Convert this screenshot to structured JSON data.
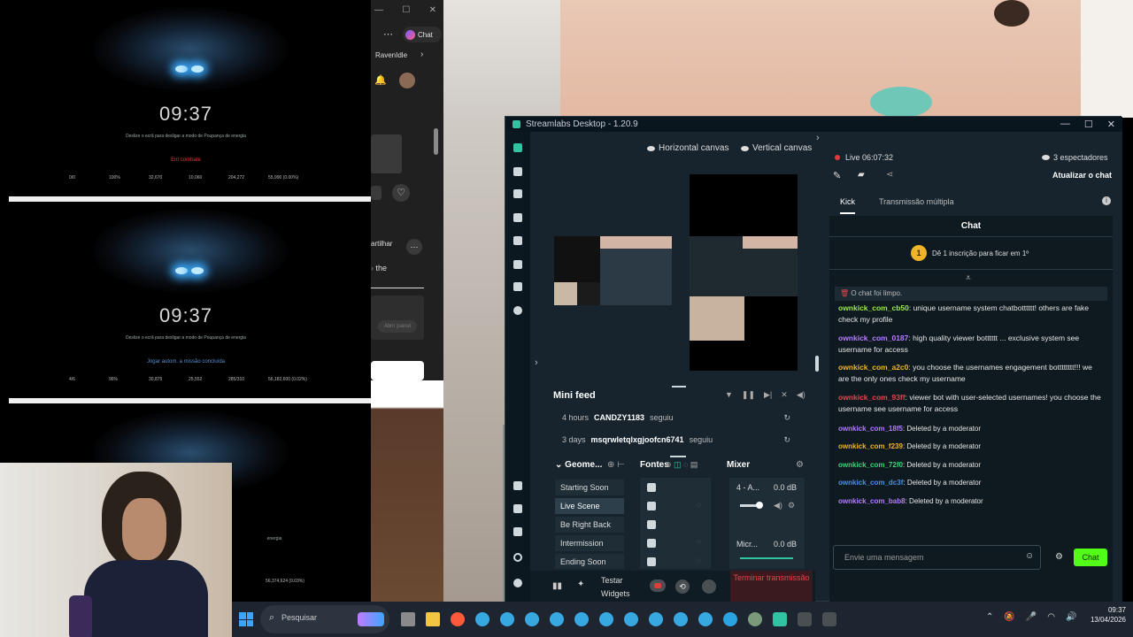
{
  "game": {
    "panels": [
      {
        "clock": "09:37",
        "sub": "Deslize o ecrã para desligar a modo de Poupança de energia",
        "status": "Em combate",
        "status_color": "#e03a3a",
        "stats": [
          "0/0",
          "100%",
          "32,670",
          "10,060",
          "204,272",
          "55,990 (0.00%)"
        ]
      },
      {
        "clock": "09:37",
        "sub": "Deslize o ecrã para desligar a modo de Poupança de energia",
        "status": "Jogar autom. a missão concluída",
        "status_color": "#5d8fd6",
        "stats": [
          "4/6",
          "96%",
          "30,875",
          "25,552",
          "285/310",
          "56,182,600 (0.02%)"
        ]
      },
      {
        "clock": "",
        "sub": "energia",
        "status": "",
        "status_color": "#fff",
        "stats": [
          "",
          "",
          "",
          "",
          "",
          "56,374,624 (0.03%)"
        ]
      }
    ]
  },
  "browser": {
    "chat_label": "Chat",
    "tab_label": "RavenIdle",
    "share_label": "artilhar",
    "the_text": "the",
    "ghost_button": "Abrir painel"
  },
  "streamlabs": {
    "title": "Streamlabs Desktop - 1.20.9",
    "horizontal_canvas": "Horizontal canvas",
    "vertical_canvas": "Vertical canvas",
    "mini_feed": {
      "title": "Mini feed",
      "rows": [
        {
          "time": "4 hours",
          "user": "CANDZY1183",
          "action": "seguiu"
        },
        {
          "time": "3 days",
          "user": "msqrwletqlxgjoofcn6741",
          "action": "seguiu"
        }
      ]
    },
    "scenes": {
      "title": "Geome...",
      "items": [
        "Starting Soon",
        "Live Scene",
        "Be Right Back",
        "Intermission",
        "Ending Soon"
      ],
      "active": "Live Scene"
    },
    "sources_title": "Fontes",
    "mixer": {
      "title": "Mixer",
      "ch1_name": "4 - A...",
      "ch1_db": "0.0 dB",
      "ch2_name": "Micr...",
      "ch2_db": "0.0 dB"
    },
    "bottom": {
      "test_widgets": "Testar Widgets",
      "end_stream": "Terminar transmissão"
    },
    "live": {
      "label": "Live 06:07:32",
      "viewers": "3 espectadores",
      "refresh_chat": "Atualizar o chat"
    },
    "tabs": [
      "Kick",
      "Transmissão múltipla"
    ],
    "chat": {
      "header": "Chat",
      "sub_promo": "Dê 1 inscrição para ficar em 1º",
      "sub_rank": "1",
      "cleared": "O chat foi limpo.",
      "messages": [
        {
          "user": "ownkick_com_cb50",
          "color": "#9be84f",
          "text": ": unique username system chatbotttttt! others are fake check my profile"
        },
        {
          "user": "ownkick_com_0187",
          "color": "#b57cff",
          "text": ": high quality viewer botttttt ... exclusive system see username for access"
        },
        {
          "user": "ownkick_com_a2c0",
          "color": "#f0b429",
          "text": ": you choose the usernames engagement botttttttt!!! we are the only ones check my username"
        },
        {
          "user": "ownkick_com_93ff",
          "color": "#e0454b",
          "text": ": viewer bot with user-selected usernames! you choose the username see username for access"
        },
        {
          "user": "ownkick_com_18f5",
          "color": "#b57cff",
          "text": ": Deleted by a moderator"
        },
        {
          "user": "ownkick_com_f239",
          "color": "#f0b429",
          "text": ": Deleted by a moderator"
        },
        {
          "user": "ownkick_com_72f0",
          "color": "#3fd27a",
          "text": ": Deleted by a moderator"
        },
        {
          "user": "ownkick_com_dc3f",
          "color": "#4a90e2",
          "text": ": Deleted by a moderator"
        },
        {
          "user": "ownkick_com_bab8",
          "color": "#b57cff",
          "text": ": Deleted by a moderator"
        }
      ],
      "input_placeholder": "Envie uma mensagem",
      "send_label": "Chat"
    }
  },
  "taskbar": {
    "search_placeholder": "Pesquisar",
    "time": "09:37",
    "date": "13/04/2026"
  }
}
